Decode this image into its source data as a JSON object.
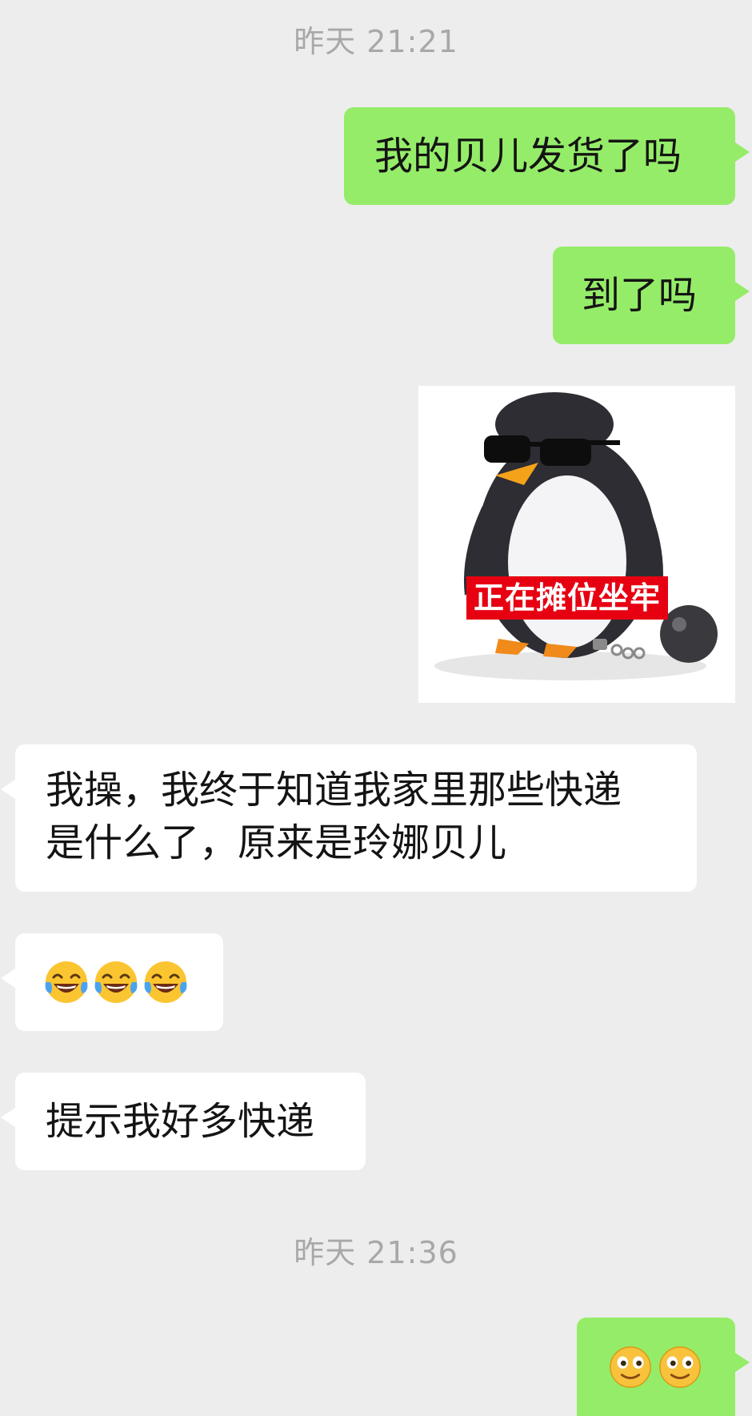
{
  "chat": {
    "timestamps": [
      "昨天 21:21",
      "昨天 21:36"
    ],
    "messages": [
      {
        "side": "out",
        "type": "text",
        "text": "我的贝儿发货了吗"
      },
      {
        "side": "out",
        "type": "text",
        "text": "到了吗"
      },
      {
        "side": "out",
        "type": "sticker",
        "caption": "正在摊位坐牢",
        "icon": "penguin-with-ball-and-chain"
      },
      {
        "side": "in",
        "type": "text",
        "lines": [
          "我操，我终于知道我家里那些快递",
          "是什么了，原来是玲娜贝儿"
        ]
      },
      {
        "side": "in",
        "type": "emoji",
        "icon": "tears-of-joy-emoji",
        "count": 3
      },
      {
        "side": "in",
        "type": "text",
        "text": "提示我好多快递"
      },
      {
        "side": "out",
        "type": "emoji",
        "icon": "smiling-face-emoji",
        "count": 2
      }
    ]
  },
  "colors": {
    "background": "#ededed",
    "outgoing_bubble": "#95ec69",
    "incoming_bubble": "#ffffff",
    "timestamp_text": "#a8a8a8",
    "sticker_caption_bg": "#e60012"
  }
}
